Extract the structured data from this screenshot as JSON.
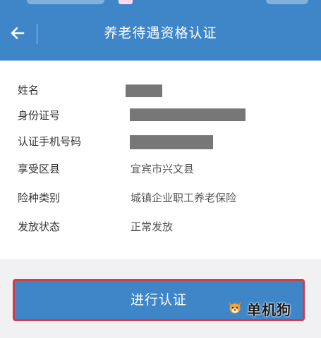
{
  "header": {
    "title": "养老待遇资格认证",
    "back_icon": "arrow-left-icon"
  },
  "info": {
    "rows": [
      {
        "label": "姓名",
        "value": "",
        "redacted": true
      },
      {
        "label": "身份证号",
        "value": "",
        "redacted": true
      },
      {
        "label": "认证手机号码",
        "value": "",
        "redacted": true
      },
      {
        "label": "享受区县",
        "value": "宜宾市兴文县"
      },
      {
        "label": "险种类别",
        "value": "城镇企业职工养老保险"
      },
      {
        "label": "发放状态",
        "value": "正常发放"
      }
    ]
  },
  "actions": {
    "primary_label": "进行认证"
  },
  "watermark": {
    "text": "单机狗",
    "icon": "dog-logo-icon"
  },
  "colors": {
    "brand_blue": "#3f86c9",
    "highlight_red": "#d13b4a",
    "redaction_gray": "#777777"
  }
}
